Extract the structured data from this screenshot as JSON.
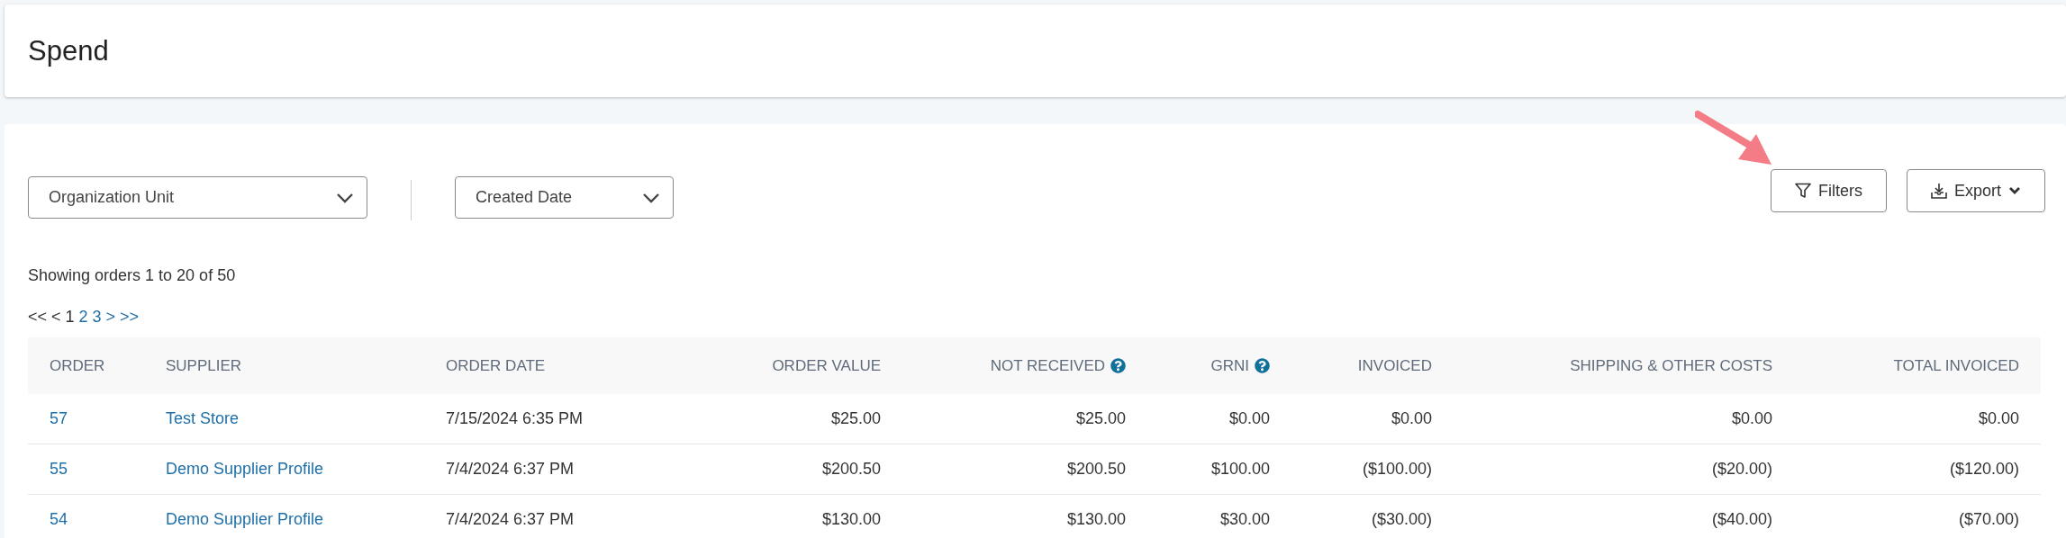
{
  "header": {
    "title": "Spend"
  },
  "filters": [
    {
      "label": "Organization Unit"
    },
    {
      "label": "Created Date"
    }
  ],
  "actions": [
    {
      "label": "Filters",
      "kind": "filter",
      "highlighted": true
    },
    {
      "label": "Export",
      "kind": "export",
      "highlighted": false
    }
  ],
  "summary": "Showing orders 1 to 20 of 50",
  "pager": [
    {
      "label": "<<",
      "disabled": true
    },
    {
      "label": "<",
      "disabled": true
    },
    {
      "label": "1",
      "disabled": true
    },
    {
      "label": "2",
      "disabled": false
    },
    {
      "label": "3",
      "disabled": false
    },
    {
      "label": ">",
      "disabled": false
    },
    {
      "label": ">>",
      "disabled": false
    }
  ],
  "table": {
    "columns": [
      {
        "label": "ORDER",
        "kind": "link",
        "help": false
      },
      {
        "label": "SUPPLIER",
        "kind": "link",
        "help": false
      },
      {
        "label": "ORDER DATE",
        "kind": "text",
        "help": false
      },
      {
        "label": "ORDER VALUE",
        "kind": "money",
        "help": false
      },
      {
        "label": "NOT RECEIVED",
        "kind": "money",
        "help": true
      },
      {
        "label": "GRNI",
        "kind": "money",
        "help": true
      },
      {
        "label": "INVOICED",
        "kind": "money",
        "help": false
      },
      {
        "label": "SHIPPING & OTHER COSTS",
        "kind": "money",
        "help": false
      },
      {
        "label": "TOTAL INVOICED",
        "kind": "money",
        "help": false
      }
    ],
    "rows": [
      {
        "cells": [
          "57",
          "Test Store",
          "7/15/2024 6:35 PM",
          "$25.00",
          "$25.00",
          "$0.00",
          "$0.00",
          "$0.00",
          "$0.00"
        ]
      },
      {
        "cells": [
          "55",
          "Demo Supplier Profile",
          "7/4/2024 6:37 PM",
          "$200.50",
          "$200.50",
          "$100.00",
          "($100.00)",
          "($20.00)",
          "($120.00)"
        ]
      },
      {
        "cells": [
          "54",
          "Demo Supplier Profile",
          "7/4/2024 6:37 PM",
          "$130.00",
          "$130.00",
          "$30.00",
          "($30.00)",
          "($40.00)",
          "($70.00)"
        ]
      }
    ]
  }
}
